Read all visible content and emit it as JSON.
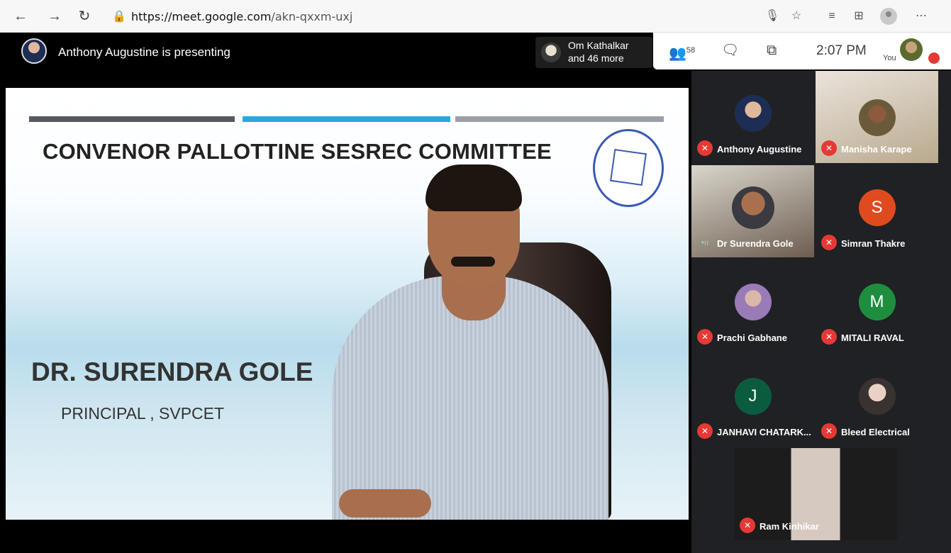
{
  "browser": {
    "back_icon": "back-arrow-icon",
    "forward_icon": "forward-arrow-icon",
    "refresh_icon": "refresh-icon",
    "url": "https://meet.google.com/akn-qxxm-uxj",
    "url_host": "https://meet.google.com",
    "url_path": "/akn-qxxm-uxj"
  },
  "meet": {
    "presenting_text": "Anthony Augustine is presenting",
    "others_line1": "Om Kathalkar",
    "others_line2": "and 46 more",
    "participant_count": "58",
    "time": "2:07 PM",
    "you_label": "You"
  },
  "slide": {
    "title": "CONVENOR PALLOTTINE SESREC COMMITTEE",
    "name": "DR. SURENDRA GOLE",
    "role": "PRINCIPAL , SVPCET",
    "bar_colors": [
      "#555a60",
      "#29a8e0",
      "#9aa0a6"
    ]
  },
  "participants": [
    {
      "name": "Anthony Augustine",
      "avatar": "",
      "muted": true,
      "color": "#1d2d54"
    },
    {
      "name": "Manisha Karape",
      "avatar": "",
      "muted": true,
      "color": "#6b5a3a"
    },
    {
      "name": "Dr Surendra Gole",
      "avatar": "",
      "muted": false,
      "color": "#7d6a55"
    },
    {
      "name": "Simran Thakre",
      "avatar": "S",
      "muted": true,
      "color": "#e04a1f"
    },
    {
      "name": "Prachi Gabhane",
      "avatar": "",
      "muted": true,
      "color": "#9b7ab8"
    },
    {
      "name": "MITALI RAVAL",
      "avatar": "M",
      "muted": true,
      "color": "#1e8e3e"
    },
    {
      "name": "JANHAVI CHATARK...",
      "avatar": "J",
      "muted": true,
      "color": "#0b5c3f"
    },
    {
      "name": "Bleed Electrical",
      "avatar": "",
      "muted": true,
      "color": "#d8d2c6"
    },
    {
      "name": "Ram Kinhikar",
      "avatar": "",
      "muted": true,
      "color": "#c9b4a8"
    }
  ]
}
